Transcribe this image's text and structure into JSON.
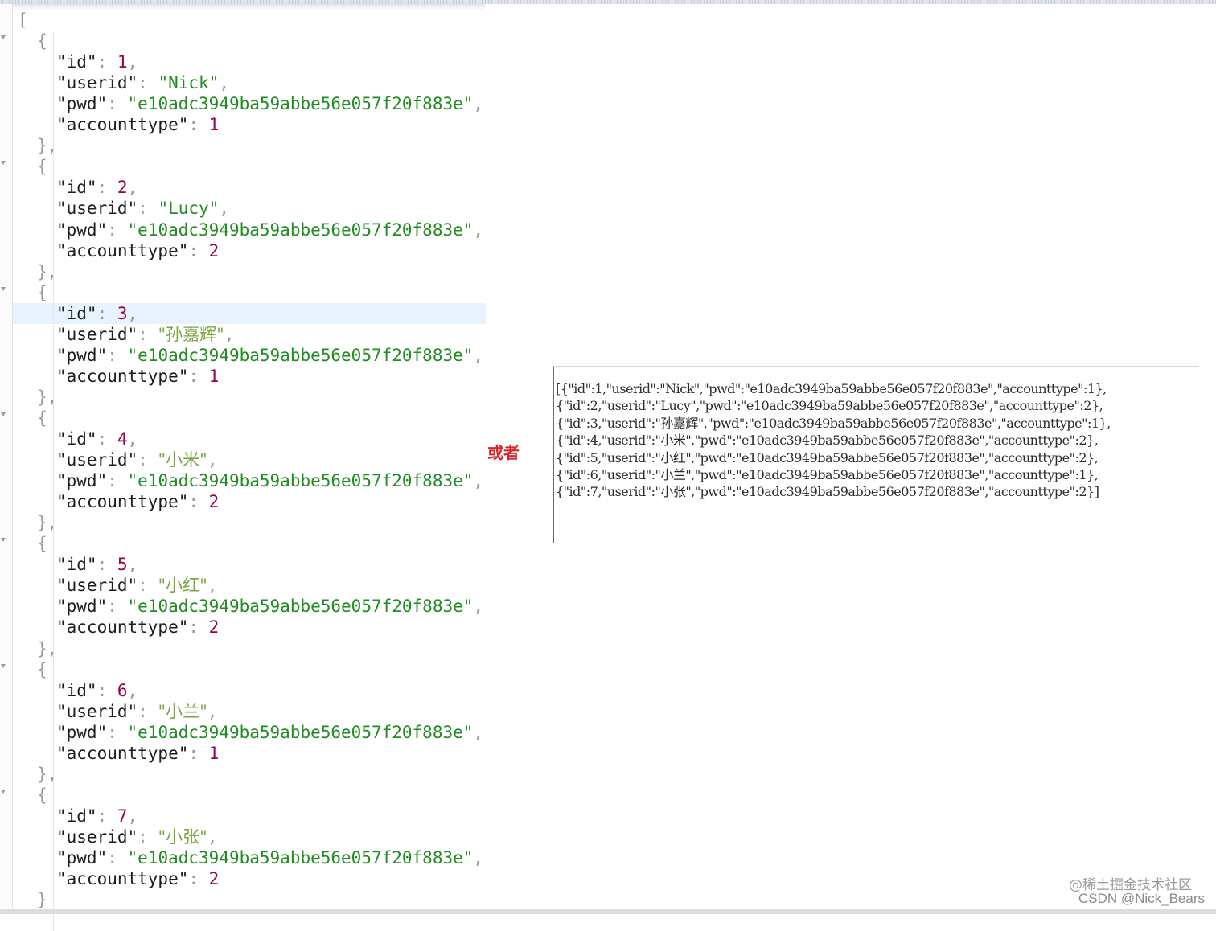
{
  "records": [
    {
      "id": "1",
      "userid": "Nick",
      "pwd": "e10adc3949ba59abbe56e057f20f883e",
      "accounttype": "1"
    },
    {
      "id": "2",
      "userid": "Lucy",
      "pwd": "e10adc3949ba59abbe56e057f20f883e",
      "accounttype": "2"
    },
    {
      "id": "3",
      "userid": "孙嘉辉",
      "pwd": "e10adc3949ba59abbe56e057f20f883e",
      "accounttype": "1"
    },
    {
      "id": "4",
      "userid": "小米",
      "pwd": "e10adc3949ba59abbe56e057f20f883e",
      "accounttype": "2"
    },
    {
      "id": "5",
      "userid": "小红",
      "pwd": "e10adc3949ba59abbe56e057f20f883e",
      "accounttype": "2"
    },
    {
      "id": "6",
      "userid": "小兰",
      "pwd": "e10adc3949ba59abbe56e057f20f883e",
      "accounttype": "1"
    },
    {
      "id": "7",
      "userid": "小张",
      "pwd": "e10adc3949ba59abbe56e057f20f883e",
      "accounttype": "2"
    }
  ],
  "middle_label": "或者",
  "raw_lines": [
    "[{\"id\":1,\"userid\":\"Nick\",\"pwd\":\"e10adc3949ba59abbe56e057f20f883e\",\"accounttype\":1},",
    "{\"id\":2,\"userid\":\"Lucy\",\"pwd\":\"e10adc3949ba59abbe56e057f20f883e\",\"accounttype\":2},",
    "{\"id\":3,\"userid\":\"孙嘉辉\",\"pwd\":\"e10adc3949ba59abbe56e057f20f883e\",\"accounttype\":1},",
    "{\"id\":4,\"userid\":\"小米\",\"pwd\":\"e10adc3949ba59abbe56e057f20f883e\",\"accounttype\":2},",
    "{\"id\":5,\"userid\":\"小红\",\"pwd\":\"e10adc3949ba59abbe56e057f20f883e\",\"accounttype\":2},",
    "{\"id\":6,\"userid\":\"小兰\",\"pwd\":\"e10adc3949ba59abbe56e057f20f883e\",\"accounttype\":1},",
    "{\"id\":7,\"userid\":\"小张\",\"pwd\":\"e10adc3949ba59abbe56e057f20f883e\",\"accounttype\":2}]"
  ],
  "watermark": "@稀土掘金技术社区",
  "watermark_csdn": "CSDN @Nick_Bears",
  "colors": {
    "key": "#1d1d1d",
    "number": "#96004c",
    "string": "#218c21",
    "highlight": "#e8f2fe",
    "label": "#d9252a"
  }
}
